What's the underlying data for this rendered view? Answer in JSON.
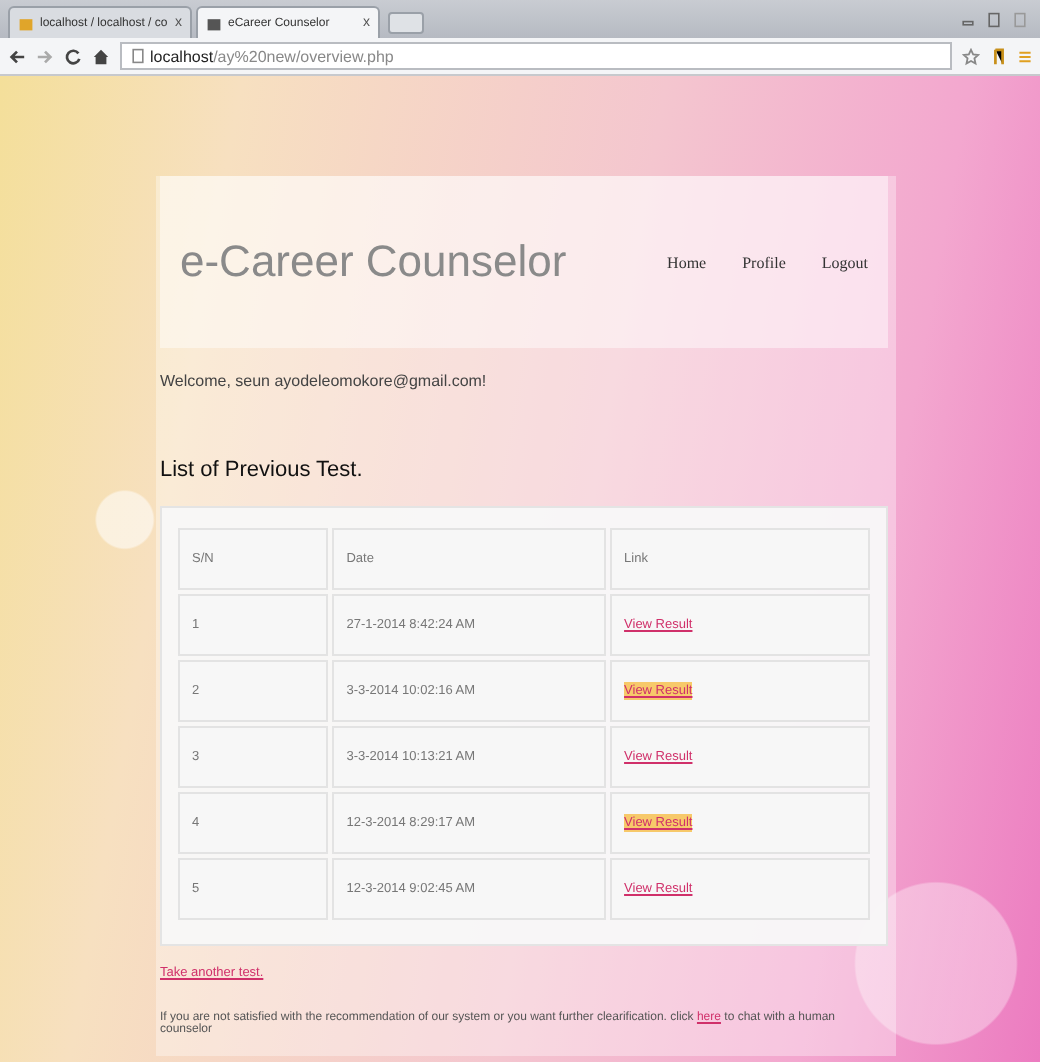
{
  "browser": {
    "tabs": [
      {
        "label": "localhost / localhost / co",
        "close": "x",
        "selected": false
      },
      {
        "label": "eCareer Counselor",
        "close": "x",
        "selected": true
      }
    ],
    "url_host": "localhost",
    "url_path": "/ay%20new/overview.php"
  },
  "header": {
    "title": "e-Career Counselor",
    "nav": [
      "Home",
      "Profile",
      "Logout"
    ]
  },
  "welcome": "Welcome, seun ayodeleomokore@gmail.com!",
  "heading": "List of Previous Test.",
  "table": {
    "columns": [
      "S/N",
      "Date",
      "Link"
    ],
    "rows": [
      {
        "sn": "1",
        "date": "27-1-2014 8:42:24 AM",
        "link": "View Result",
        "highlighted": false
      },
      {
        "sn": "2",
        "date": "3-3-2014 10:02:16 AM",
        "link": "View Result",
        "highlighted": true
      },
      {
        "sn": "3",
        "date": "3-3-2014 10:13:21 AM",
        "link": "View Result",
        "highlighted": false
      },
      {
        "sn": "4",
        "date": "12-3-2014 8:29:17 AM",
        "link": "View Result",
        "highlighted": true
      },
      {
        "sn": "5",
        "date": "12-3-2014 9:02:45 AM",
        "link": "View Result",
        "highlighted": false
      }
    ]
  },
  "another_test": "Take another test.",
  "footer": {
    "before": "If you are not satisfied with the recommendation of our system or you want further clearification. click",
    "link": "here",
    "after": "to chat with a human counselor"
  }
}
